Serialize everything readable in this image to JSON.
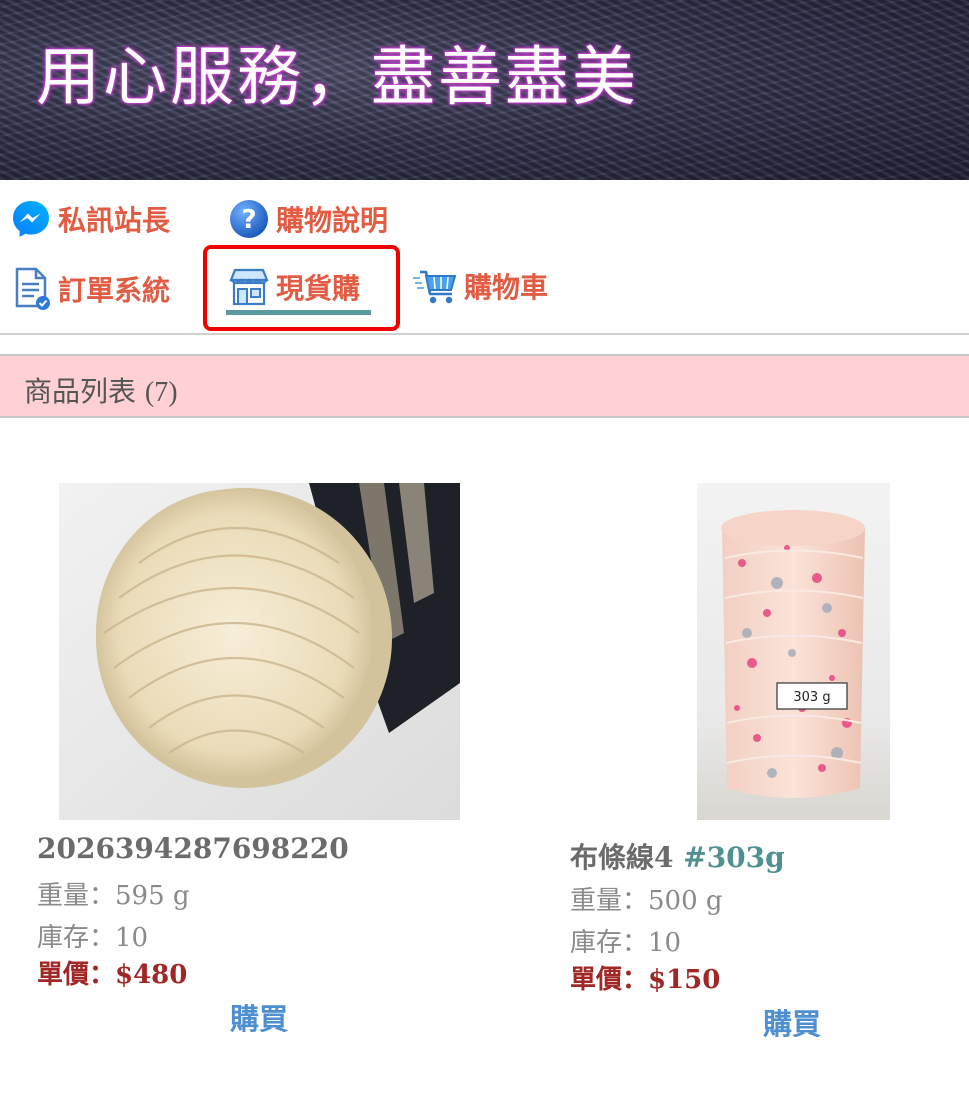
{
  "banner": {
    "title": "用心服務，盡善盡美"
  },
  "nav": {
    "messenger": "私訊站長",
    "help": "購物說明",
    "orders": "訂單系統",
    "instock": "現貨購",
    "cart": "購物車",
    "active": "instock",
    "accent_color": "#e15c43",
    "highlight_color": "#f20000"
  },
  "list": {
    "title": "商品列表",
    "count": "(7)",
    "header_bg": "#ffd1d4"
  },
  "products": [
    {
      "name": "2026394287698220",
      "code": "",
      "weight": "重量：595 g",
      "stock": "庫存：10",
      "price": "單價：$480",
      "buy": "購買"
    },
    {
      "name": "布條線4 ",
      "code": "#303g",
      "weight": "重量：500 g",
      "stock": "庫存：10",
      "price": "單價：$150",
      "buy": "購買",
      "label_on_spool": "303 g"
    }
  ],
  "colors": {
    "price": "#a12727",
    "buy": "#4d8fd1",
    "code": "#4f9090"
  },
  "icons": [
    "messenger-icon",
    "help-icon",
    "order-doc-icon",
    "store-icon",
    "cart-icon"
  ]
}
